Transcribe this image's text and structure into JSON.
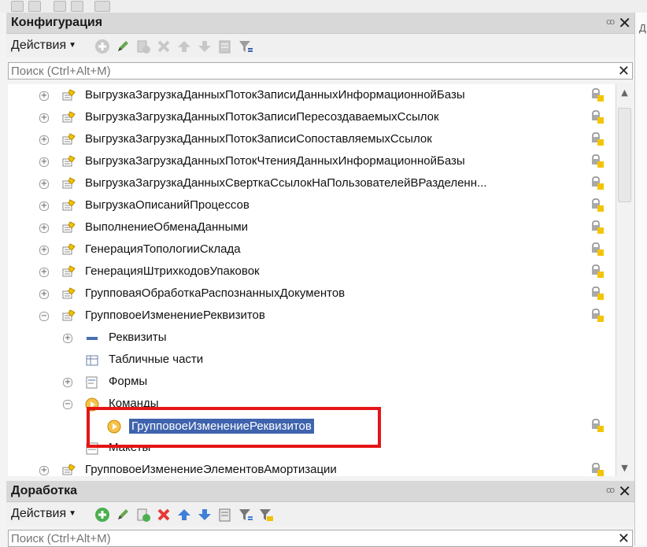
{
  "config_panel": {
    "title": "Конфигурация",
    "actions_label": "Действия",
    "search_placeholder": "Поиск (Ctrl+Alt+M)"
  },
  "tree": {
    "items": [
      {
        "label": "ВыгрузкаЗагрузкаДанныхПотокЗаписиДанныхИнформационнойБазы"
      },
      {
        "label": "ВыгрузкаЗагрузкаДанныхПотокЗаписиПересоздаваемыхСсылок"
      },
      {
        "label": "ВыгрузкаЗагрузкаДанныхПотокЗаписиСопоставляемыхСсылок"
      },
      {
        "label": "ВыгрузкаЗагрузкаДанныхПотокЧтенияДанныхИнформационнойБазы"
      },
      {
        "label": "ВыгрузкаЗагрузкаДанныхСверткаСсылокНаПользователейВРазделенн..."
      },
      {
        "label": "ВыгрузкаОписанийПроцессов"
      },
      {
        "label": "ВыполнениеОбменаДанными"
      },
      {
        "label": "ГенерацияТопологииСклада"
      },
      {
        "label": "ГенерацияШтрихкодовУпаковок"
      },
      {
        "label": "ГрупповаяОбработкаРаспознанныхДокументов"
      },
      {
        "label": "ГрупповоеИзменениеРеквизитов"
      }
    ],
    "children": {
      "requisites": "Реквизиты",
      "tabular": "Табличные части",
      "forms": "Формы",
      "commands": "Команды",
      "command_item": "ГрупповоеИзменениеРеквизитов",
      "layouts": "Макеты"
    },
    "last_item": "ГрупповоеИзменениеЭлементовАмортизации"
  },
  "dev_panel": {
    "title": "Доработка",
    "actions_label": "Действия",
    "search_placeholder": "Поиск (Ctrl+Alt+M)"
  },
  "right_edge_text": "Д",
  "colors": {
    "selection": "#3f63ad",
    "highlight_box": "#e51515",
    "panel_header": "#d8d8d8"
  }
}
